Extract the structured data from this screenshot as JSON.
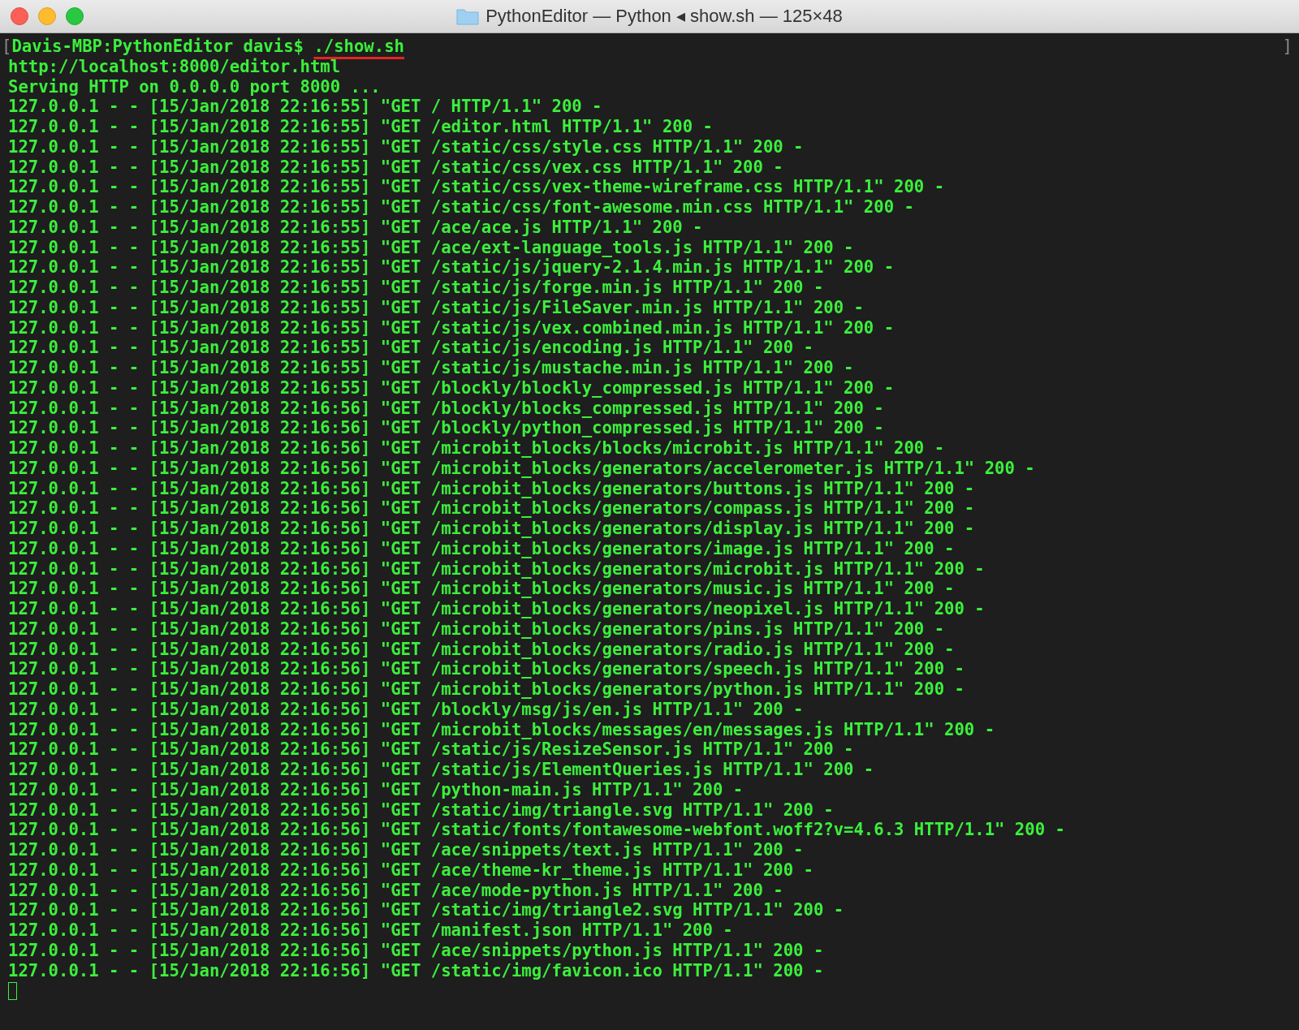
{
  "window": {
    "title": "PythonEditor — Python ◂ show.sh — 125×48"
  },
  "prompt_line": {
    "mark_open": "[",
    "prompt": "Davis-MBP:PythonEditor davis$ ",
    "command": "./show.sh",
    "command_underlined": true,
    "mark_close": "]"
  },
  "output": [
    "http://localhost:8000/editor.html",
    "Serving HTTP on 0.0.0.0 port 8000 ...",
    "127.0.0.1 - - [15/Jan/2018 22:16:55] \"GET / HTTP/1.1\" 200 -",
    "127.0.0.1 - - [15/Jan/2018 22:16:55] \"GET /editor.html HTTP/1.1\" 200 -",
    "127.0.0.1 - - [15/Jan/2018 22:16:55] \"GET /static/css/style.css HTTP/1.1\" 200 -",
    "127.0.0.1 - - [15/Jan/2018 22:16:55] \"GET /static/css/vex.css HTTP/1.1\" 200 -",
    "127.0.0.1 - - [15/Jan/2018 22:16:55] \"GET /static/css/vex-theme-wireframe.css HTTP/1.1\" 200 -",
    "127.0.0.1 - - [15/Jan/2018 22:16:55] \"GET /static/css/font-awesome.min.css HTTP/1.1\" 200 -",
    "127.0.0.1 - - [15/Jan/2018 22:16:55] \"GET /ace/ace.js HTTP/1.1\" 200 -",
    "127.0.0.1 - - [15/Jan/2018 22:16:55] \"GET /ace/ext-language_tools.js HTTP/1.1\" 200 -",
    "127.0.0.1 - - [15/Jan/2018 22:16:55] \"GET /static/js/jquery-2.1.4.min.js HTTP/1.1\" 200 -",
    "127.0.0.1 - - [15/Jan/2018 22:16:55] \"GET /static/js/forge.min.js HTTP/1.1\" 200 -",
    "127.0.0.1 - - [15/Jan/2018 22:16:55] \"GET /static/js/FileSaver.min.js HTTP/1.1\" 200 -",
    "127.0.0.1 - - [15/Jan/2018 22:16:55] \"GET /static/js/vex.combined.min.js HTTP/1.1\" 200 -",
    "127.0.0.1 - - [15/Jan/2018 22:16:55] \"GET /static/js/encoding.js HTTP/1.1\" 200 -",
    "127.0.0.1 - - [15/Jan/2018 22:16:55] \"GET /static/js/mustache.min.js HTTP/1.1\" 200 -",
    "127.0.0.1 - - [15/Jan/2018 22:16:55] \"GET /blockly/blockly_compressed.js HTTP/1.1\" 200 -",
    "127.0.0.1 - - [15/Jan/2018 22:16:56] \"GET /blockly/blocks_compressed.js HTTP/1.1\" 200 -",
    "127.0.0.1 - - [15/Jan/2018 22:16:56] \"GET /blockly/python_compressed.js HTTP/1.1\" 200 -",
    "127.0.0.1 - - [15/Jan/2018 22:16:56] \"GET /microbit_blocks/blocks/microbit.js HTTP/1.1\" 200 -",
    "127.0.0.1 - - [15/Jan/2018 22:16:56] \"GET /microbit_blocks/generators/accelerometer.js HTTP/1.1\" 200 -",
    "127.0.0.1 - - [15/Jan/2018 22:16:56] \"GET /microbit_blocks/generators/buttons.js HTTP/1.1\" 200 -",
    "127.0.0.1 - - [15/Jan/2018 22:16:56] \"GET /microbit_blocks/generators/compass.js HTTP/1.1\" 200 -",
    "127.0.0.1 - - [15/Jan/2018 22:16:56] \"GET /microbit_blocks/generators/display.js HTTP/1.1\" 200 -",
    "127.0.0.1 - - [15/Jan/2018 22:16:56] \"GET /microbit_blocks/generators/image.js HTTP/1.1\" 200 -",
    "127.0.0.1 - - [15/Jan/2018 22:16:56] \"GET /microbit_blocks/generators/microbit.js HTTP/1.1\" 200 -",
    "127.0.0.1 - - [15/Jan/2018 22:16:56] \"GET /microbit_blocks/generators/music.js HTTP/1.1\" 200 -",
    "127.0.0.1 - - [15/Jan/2018 22:16:56] \"GET /microbit_blocks/generators/neopixel.js HTTP/1.1\" 200 -",
    "127.0.0.1 - - [15/Jan/2018 22:16:56] \"GET /microbit_blocks/generators/pins.js HTTP/1.1\" 200 -",
    "127.0.0.1 - - [15/Jan/2018 22:16:56] \"GET /microbit_blocks/generators/radio.js HTTP/1.1\" 200 -",
    "127.0.0.1 - - [15/Jan/2018 22:16:56] \"GET /microbit_blocks/generators/speech.js HTTP/1.1\" 200 -",
    "127.0.0.1 - - [15/Jan/2018 22:16:56] \"GET /microbit_blocks/generators/python.js HTTP/1.1\" 200 -",
    "127.0.0.1 - - [15/Jan/2018 22:16:56] \"GET /blockly/msg/js/en.js HTTP/1.1\" 200 -",
    "127.0.0.1 - - [15/Jan/2018 22:16:56] \"GET /microbit_blocks/messages/en/messages.js HTTP/1.1\" 200 -",
    "127.0.0.1 - - [15/Jan/2018 22:16:56] \"GET /static/js/ResizeSensor.js HTTP/1.1\" 200 -",
    "127.0.0.1 - - [15/Jan/2018 22:16:56] \"GET /static/js/ElementQueries.js HTTP/1.1\" 200 -",
    "127.0.0.1 - - [15/Jan/2018 22:16:56] \"GET /python-main.js HTTP/1.1\" 200 -",
    "127.0.0.1 - - [15/Jan/2018 22:16:56] \"GET /static/img/triangle.svg HTTP/1.1\" 200 -",
    "127.0.0.1 - - [15/Jan/2018 22:16:56] \"GET /static/fonts/fontawesome-webfont.woff2?v=4.6.3 HTTP/1.1\" 200 -",
    "127.0.0.1 - - [15/Jan/2018 22:16:56] \"GET /ace/snippets/text.js HTTP/1.1\" 200 -",
    "127.0.0.1 - - [15/Jan/2018 22:16:56] \"GET /ace/theme-kr_theme.js HTTP/1.1\" 200 -",
    "127.0.0.1 - - [15/Jan/2018 22:16:56] \"GET /ace/mode-python.js HTTP/1.1\" 200 -",
    "127.0.0.1 - - [15/Jan/2018 22:16:56] \"GET /static/img/triangle2.svg HTTP/1.1\" 200 -",
    "127.0.0.1 - - [15/Jan/2018 22:16:56] \"GET /manifest.json HTTP/1.1\" 200 -",
    "127.0.0.1 - - [15/Jan/2018 22:16:56] \"GET /ace/snippets/python.js HTTP/1.1\" 200 -",
    "127.0.0.1 - - [15/Jan/2018 22:16:56] \"GET /static/img/favicon.ico HTTP/1.1\" 200 -"
  ]
}
